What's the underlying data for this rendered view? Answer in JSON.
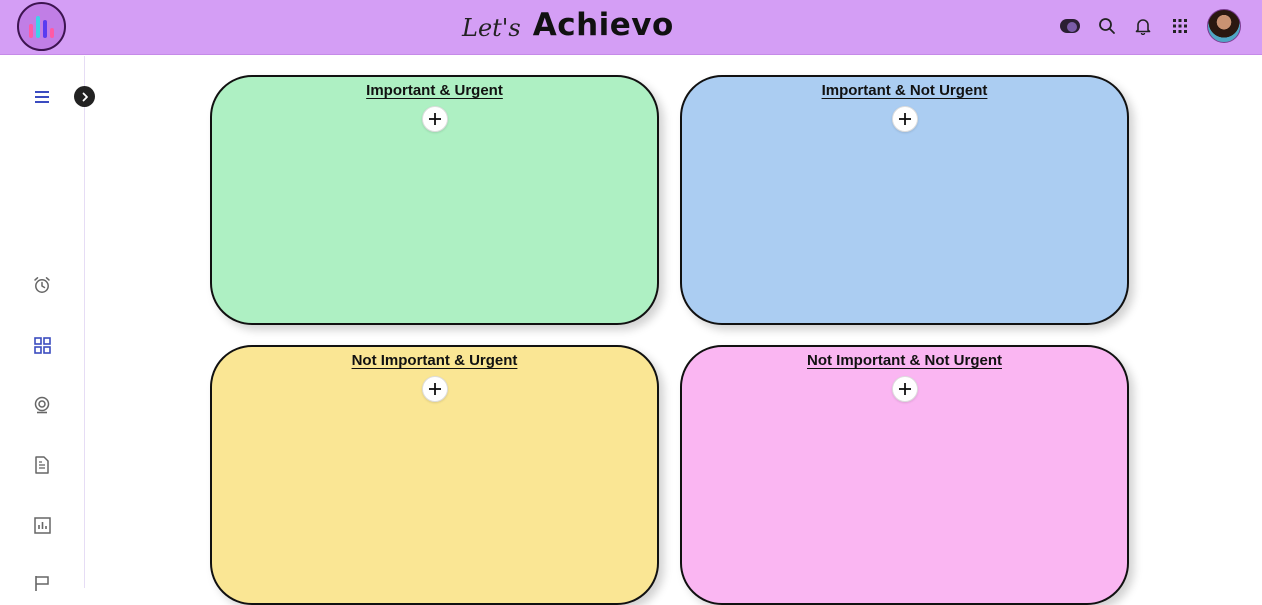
{
  "header": {
    "brand_script": "Let's",
    "brand_main": "Achievo",
    "icons": [
      "toggle-icon",
      "search-icon",
      "bell-icon",
      "apps-grid-icon"
    ],
    "background_color": "#d49ef5"
  },
  "sidebar": {
    "icons": [
      "menu-icon",
      "alarm-clock-icon",
      "dashboard-grid-icon",
      "webcam-icon",
      "document-icon",
      "bar-chart-icon",
      "flag-icon"
    ],
    "active_color": "#3b4cc0"
  },
  "quadrants": [
    {
      "title": "Important & Urgent",
      "color": "#aef0c3"
    },
    {
      "title": "Important & Not Urgent",
      "color": "#abcdf2"
    },
    {
      "title": "Not Important & Urgent",
      "color": "#fae694"
    },
    {
      "title": "Not Important & Not Urgent",
      "color": "#fab6f2"
    }
  ]
}
